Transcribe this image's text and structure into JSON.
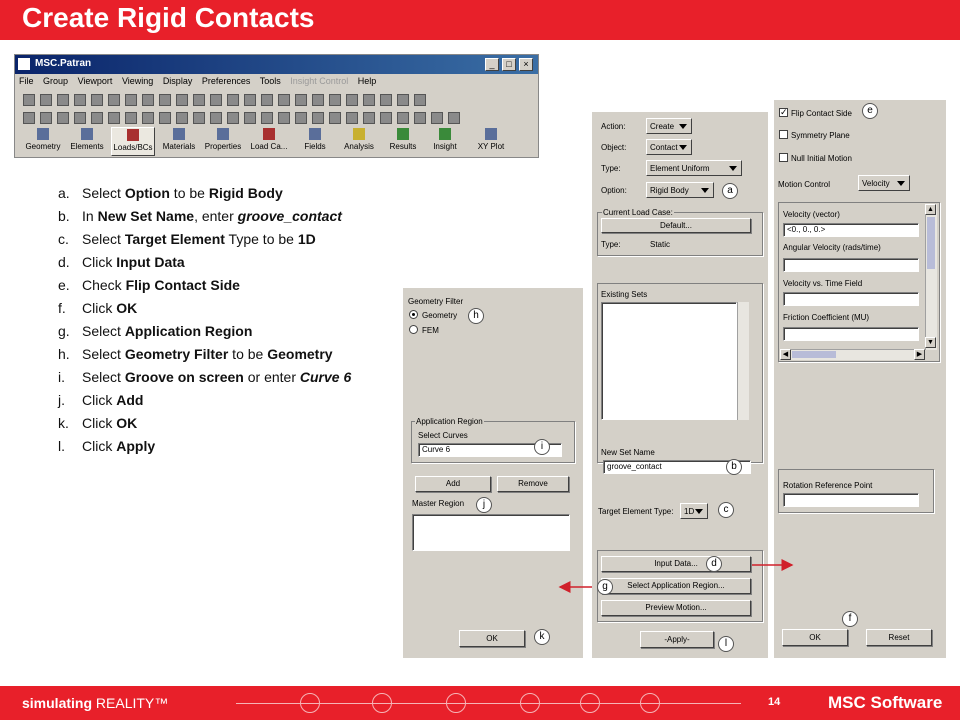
{
  "title": "Create Rigid Contacts",
  "patran": {
    "window_title": "MSC.Patran",
    "menu": [
      "File",
      "Group",
      "Viewport",
      "Viewing",
      "Display",
      "Preferences",
      "Tools",
      "Insight Control",
      "Help"
    ],
    "apps": [
      "Geometry",
      "Elements",
      "Loads/BCs",
      "Materials",
      "Properties",
      "Load Ca...",
      "Fields",
      "Analysis",
      "Results",
      "Insight",
      "XY Plot"
    ],
    "selected_app": "Loads/BCs"
  },
  "steps": [
    {
      "key": "a.",
      "html": "Select <b>Option</b> to be <b>Rigid Body</b>"
    },
    {
      "key": "b.",
      "html": "In <b>New Set Name</b>, enter <i>groove_contact</i>"
    },
    {
      "key": "c.",
      "html": "Select <b>Target Element</b> Type to be <b>1D</b>"
    },
    {
      "key": "d.",
      "html": "Click <b>Input Data</b>"
    },
    {
      "key": "e.",
      "html": "Check <b>Flip Contact Side</b>"
    },
    {
      "key": "f.",
      "html": "Click <b>OK</b>"
    },
    {
      "key": "g.",
      "html": "Select <b>Application Region</b>"
    },
    {
      "key": "h.",
      "html": "Select <b>Geometry Filter</b> to be <b>Geometry</b>"
    },
    {
      "key": "i.",
      "html": "Select <b>Groove on screen</b> or enter <i>Curve 6</i>"
    },
    {
      "key": "j.",
      "html": "Click <b>Add</b>"
    },
    {
      "key": "k.",
      "html": "Click <b>OK</b>"
    },
    {
      "key": "l.",
      "html": "Click <b>Apply</b>"
    }
  ],
  "app_region_panel": {
    "geometry_filter_label": "Geometry Filter",
    "radio_geometry": "Geometry",
    "radio_fem": "FEM",
    "app_region_group": "Application Region",
    "select_curves_label": "Select Curves",
    "select_curves_value": "Curve 6",
    "add_button": "Add",
    "remove_button": "Remove",
    "master_region_label": "Master Region",
    "ok_button": "OK"
  },
  "main_panel": {
    "action_label": "Action:",
    "action_value": "Create",
    "object_label": "Object:",
    "object_value": "Contact",
    "type_label": "Type:",
    "type_value": "Element Uniform",
    "option_label": "Option:",
    "option_value": "Rigid Body",
    "current_load_case_label": "Current Load Case:",
    "default_button": "Default...",
    "lc_type_label": "Type:",
    "lc_type_value": "Static",
    "existing_sets_label": "Existing Sets",
    "new_set_name_label": "New Set Name",
    "new_set_name_value": "groove_contact",
    "target_element_type_label": "Target Element Type:",
    "target_element_type_value": "1D",
    "input_data_button": "Input Data...",
    "select_app_region_button": "Select Application Region...",
    "preview_motion_button": "Preview Motion...",
    "apply_button": "-Apply-"
  },
  "input_data_panel": {
    "flip_contact_side": "Flip Contact Side",
    "flip_checked": true,
    "symmetry_plane": "Symmetry Plane",
    "null_initial_motion": "Null Initial Motion",
    "motion_control_label": "Motion Control",
    "motion_control_value": "Velocity",
    "velocity_vector_label": "Velocity (vector)",
    "velocity_vector_value": "<0., 0., 0.>",
    "angular_velocity_label": "Angular Velocity (rads/time)",
    "velocity_time_field_label": "Velocity vs. Time Field",
    "friction_coefficient_label": "Friction Coefficient (MU)",
    "rotation_reference_point_label": "Rotation Reference Point",
    "ok_button": "OK",
    "reset_button": "Reset"
  },
  "callouts": {
    "a": "a",
    "b": "b",
    "c": "c",
    "d": "d",
    "e": "e",
    "f": "f",
    "g": "g",
    "h": "h",
    "i": "i",
    "j": "j",
    "k": "k",
    "l": "l"
  },
  "footer": {
    "brand_bold": "simulating",
    "brand_rest": "REALITY™",
    "page_number": "14",
    "company": "MSC Software"
  },
  "colors": {
    "accent": "#e8202a",
    "panel": "#d4d0c8",
    "titlebar": "#0a246a"
  }
}
